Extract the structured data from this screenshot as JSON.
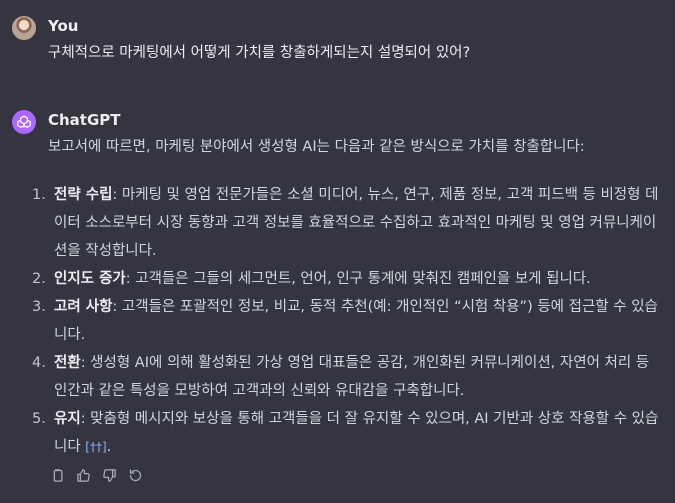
{
  "user_message": {
    "author": "You",
    "text": "구체적으로 마케팅에서 어떻게 가치를 창출하게되는지 설명되어 있어?"
  },
  "assistant_message": {
    "author": "ChatGPT",
    "intro": "보고서에 따르면, 마케팅 분야에서 생성형 AI는 다음과 같은 방식으로 가치를 창출합니다:",
    "points": [
      {
        "number": "1.",
        "term": "전략 수립",
        "text": ": 마케팅 및 영업 전문가들은 소셜 미디어, 뉴스, 연구, 제품 정보, 고객 피드백 등 비정형 데이터 소스로부터 시장 동향과 고객 정보를 효율적으로 수집하고 효과적인 마케팅 및 영업 커뮤니케이션을 작성합니다."
      },
      {
        "number": "2.",
        "term": "인지도 증가",
        "text": ": 고객들은 그들의 세그먼트, 언어, 인구 통계에 맞춰진 캠페인을 보게 됩니다."
      },
      {
        "number": "3.",
        "term": "고려 사항",
        "text": ": 고객들은 포괄적인 정보, 비교, 동적 추천(예: 개인적인 “시험 착용”) 등에 접근할 수 있습니다."
      },
      {
        "number": "4.",
        "term": "전환",
        "text": ": 생성형 AI에 의해 활성화된 가상 영업 대표들은 공감, 개인화된 커뮤니케이션, 자연어 처리 등 인간과 같은 특성을 모방하여 고객과의 신뢰와 유대감을 구축합니다."
      },
      {
        "number": "5.",
        "term": "유지",
        "text": ": 맞춤형 메시지와 보상을 통해 고객들을 더 잘 유지할 수 있으며, AI 기반과 상호 작용할 수 있습니다 ",
        "citation": "[††]",
        "tail": "."
      }
    ]
  },
  "actions": [
    {
      "name": "copy-icon"
    },
    {
      "name": "thumbs-up-icon"
    },
    {
      "name": "thumbs-down-icon"
    },
    {
      "name": "regenerate-icon"
    }
  ],
  "colors": {
    "background": "#343541",
    "text": "#d1d5db",
    "bot_avatar": "#ab68ff",
    "citation": "#8ab4f8"
  }
}
